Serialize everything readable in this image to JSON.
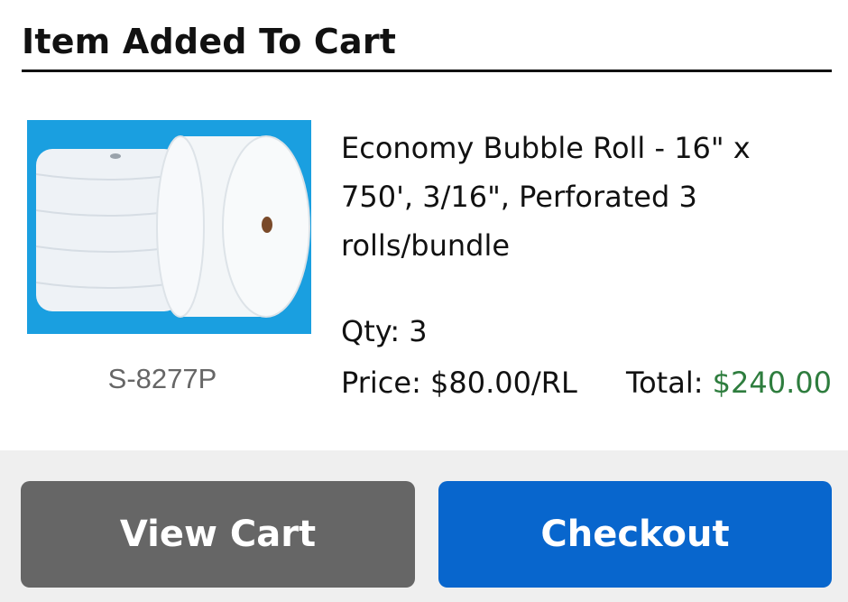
{
  "dialog": {
    "title": "Item Added To Cart"
  },
  "item": {
    "image_alt": "Bubble roll product image",
    "sku": "S-8277P",
    "name": "Economy Bubble Roll - 16\" x 750', 3/16\", Perforated 3 rolls/bundle",
    "qty_label": "Qty:",
    "qty": "3",
    "price_label": "Price:",
    "price": "$80.00/RL",
    "total_label": "Total:",
    "total": "$240.00"
  },
  "actions": {
    "view_cart_label": "View Cart",
    "checkout_label": "Checkout"
  },
  "colors": {
    "image_background": "#1a9fe0",
    "view_cart_bg": "#666666",
    "checkout_bg": "#0866cd",
    "total_value": "#2e7d3e",
    "footer_bg": "#efefef"
  }
}
